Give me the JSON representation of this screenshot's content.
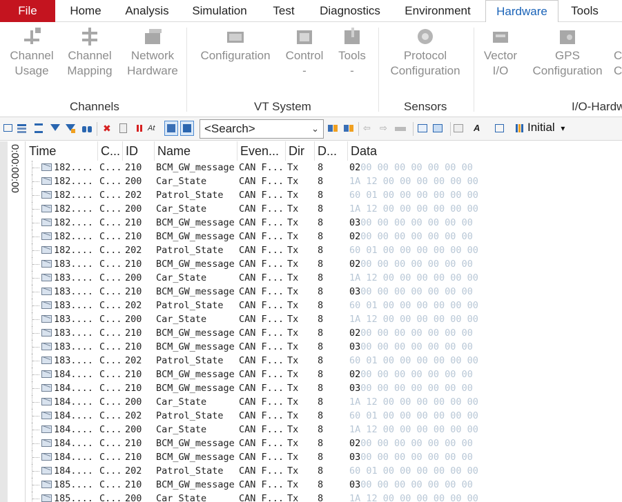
{
  "menu": {
    "tabs": [
      {
        "label": "File"
      },
      {
        "label": "Home"
      },
      {
        "label": "Analysis"
      },
      {
        "label": "Simulation"
      },
      {
        "label": "Test"
      },
      {
        "label": "Diagnostics"
      },
      {
        "label": "Environment"
      },
      {
        "label": "Hardware"
      },
      {
        "label": "Tools"
      }
    ],
    "active": "Hardware"
  },
  "ribbon": {
    "buttons": [
      {
        "line1": "Channel",
        "line2": "Usage"
      },
      {
        "line1": "Channel",
        "line2": "Mapping"
      },
      {
        "line1": "Network",
        "line2": "Hardware"
      },
      {
        "line1": "Configuration",
        "line2": ""
      },
      {
        "line1": "Control",
        "line2": "-"
      },
      {
        "line1": "Tools",
        "line2": "-"
      },
      {
        "line1": "Protocol",
        "line2": "Configuration"
      },
      {
        "line1": "Vector",
        "line2": "I/O"
      },
      {
        "line1": "GPS",
        "line2": "Configuration"
      },
      {
        "line1": "C",
        "line2": "C"
      }
    ],
    "groups": [
      "Channels",
      "VT System",
      "Sensors",
      "I/O-Hardw"
    ]
  },
  "toolbar": {
    "search_text": "<Search>",
    "search_dropdown": "⌄",
    "layout_label": "Initial",
    "layout_dropdown": "▾"
  },
  "side": {
    "time_label": "0:00:00:00"
  },
  "table": {
    "columns": [
      "Time",
      "C...",
      "ID",
      "Name",
      "Even...",
      "Dir",
      "D...",
      "Data"
    ],
    "rows": [
      {
        "time": "182....",
        "chn": "C...",
        "id": "210",
        "name": "BCM_GW_message",
        "event": "CAN F...",
        "dir": "Tx",
        "dlc": "8",
        "b0": "02",
        "rest": "00 00 00 00 00 00 00"
      },
      {
        "time": "182....",
        "chn": "C...",
        "id": "200",
        "name": "Car_State",
        "event": "CAN F...",
        "dir": "Tx",
        "dlc": "8",
        "b0": "",
        "rest": "1A 12 00 00 00 00 00 00"
      },
      {
        "time": "182....",
        "chn": "C...",
        "id": "202",
        "name": "Patrol_State",
        "event": "CAN F...",
        "dir": "Tx",
        "dlc": "8",
        "b0": "",
        "rest": "60 01 00 00 00 00 00 00"
      },
      {
        "time": "182....",
        "chn": "C...",
        "id": "200",
        "name": "Car_State",
        "event": "CAN F...",
        "dir": "Tx",
        "dlc": "8",
        "b0": "",
        "rest": "1A 12 00 00 00 00 00 00"
      },
      {
        "time": "182....",
        "chn": "C...",
        "id": "210",
        "name": "BCM_GW_message",
        "event": "CAN F...",
        "dir": "Tx",
        "dlc": "8",
        "b0": "03",
        "rest": "00 00 00 00 00 00 00"
      },
      {
        "time": "182....",
        "chn": "C...",
        "id": "210",
        "name": "BCM_GW_message",
        "event": "CAN F...",
        "dir": "Tx",
        "dlc": "8",
        "b0": "02",
        "rest": "00 00 00 00 00 00 00"
      },
      {
        "time": "182....",
        "chn": "C...",
        "id": "202",
        "name": "Patrol_State",
        "event": "CAN F...",
        "dir": "Tx",
        "dlc": "8",
        "b0": "",
        "rest": "60 01 00 00 00 00 00 00"
      },
      {
        "time": "183....",
        "chn": "C...",
        "id": "210",
        "name": "BCM_GW_message",
        "event": "CAN F...",
        "dir": "Tx",
        "dlc": "8",
        "b0": "02",
        "rest": "00 00 00 00 00 00 00"
      },
      {
        "time": "183....",
        "chn": "C...",
        "id": "200",
        "name": "Car_State",
        "event": "CAN F...",
        "dir": "Tx",
        "dlc": "8",
        "b0": "",
        "rest": "1A 12 00 00 00 00 00 00"
      },
      {
        "time": "183....",
        "chn": "C...",
        "id": "210",
        "name": "BCM_GW_message",
        "event": "CAN F...",
        "dir": "Tx",
        "dlc": "8",
        "b0": "03",
        "rest": "00 00 00 00 00 00 00"
      },
      {
        "time": "183....",
        "chn": "C...",
        "id": "202",
        "name": "Patrol_State",
        "event": "CAN F...",
        "dir": "Tx",
        "dlc": "8",
        "b0": "",
        "rest": "60 01 00 00 00 00 00 00"
      },
      {
        "time": "183....",
        "chn": "C...",
        "id": "200",
        "name": "Car_State",
        "event": "CAN F...",
        "dir": "Tx",
        "dlc": "8",
        "b0": "",
        "rest": "1A 12 00 00 00 00 00 00"
      },
      {
        "time": "183....",
        "chn": "C...",
        "id": "210",
        "name": "BCM_GW_message",
        "event": "CAN F...",
        "dir": "Tx",
        "dlc": "8",
        "b0": "02",
        "rest": "00 00 00 00 00 00 00"
      },
      {
        "time": "183....",
        "chn": "C...",
        "id": "210",
        "name": "BCM_GW_message",
        "event": "CAN F...",
        "dir": "Tx",
        "dlc": "8",
        "b0": "03",
        "rest": "00 00 00 00 00 00 00"
      },
      {
        "time": "183....",
        "chn": "C...",
        "id": "202",
        "name": "Patrol_State",
        "event": "CAN F...",
        "dir": "Tx",
        "dlc": "8",
        "b0": "",
        "rest": "60 01 00 00 00 00 00 00"
      },
      {
        "time": "184....",
        "chn": "C...",
        "id": "210",
        "name": "BCM_GW_message",
        "event": "CAN F...",
        "dir": "Tx",
        "dlc": "8",
        "b0": "02",
        "rest": "00 00 00 00 00 00 00"
      },
      {
        "time": "184....",
        "chn": "C...",
        "id": "210",
        "name": "BCM_GW_message",
        "event": "CAN F...",
        "dir": "Tx",
        "dlc": "8",
        "b0": "03",
        "rest": "00 00 00 00 00 00 00"
      },
      {
        "time": "184....",
        "chn": "C...",
        "id": "200",
        "name": "Car_State",
        "event": "CAN F...",
        "dir": "Tx",
        "dlc": "8",
        "b0": "",
        "rest": "1A 12 00 00 00 00 00 00"
      },
      {
        "time": "184....",
        "chn": "C...",
        "id": "202",
        "name": "Patrol_State",
        "event": "CAN F...",
        "dir": "Tx",
        "dlc": "8",
        "b0": "",
        "rest": "60 01 00 00 00 00 00 00"
      },
      {
        "time": "184....",
        "chn": "C...",
        "id": "200",
        "name": "Car_State",
        "event": "CAN F...",
        "dir": "Tx",
        "dlc": "8",
        "b0": "",
        "rest": "1A 12 00 00 00 00 00 00"
      },
      {
        "time": "184....",
        "chn": "C...",
        "id": "210",
        "name": "BCM_GW_message",
        "event": "CAN F...",
        "dir": "Tx",
        "dlc": "8",
        "b0": "02",
        "rest": "00 00 00 00 00 00 00"
      },
      {
        "time": "184....",
        "chn": "C...",
        "id": "210",
        "name": "BCM_GW_message",
        "event": "CAN F...",
        "dir": "Tx",
        "dlc": "8",
        "b0": "03",
        "rest": "00 00 00 00 00 00 00"
      },
      {
        "time": "184....",
        "chn": "C...",
        "id": "202",
        "name": "Patrol_State",
        "event": "CAN F...",
        "dir": "Tx",
        "dlc": "8",
        "b0": "",
        "rest": "60 01 00 00 00 00 00 00"
      },
      {
        "time": "185....",
        "chn": "C...",
        "id": "210",
        "name": "BCM_GW_message",
        "event": "CAN F...",
        "dir": "Tx",
        "dlc": "8",
        "b0": "03",
        "rest": "00 00 00 00 00 00 00"
      },
      {
        "time": "185....",
        "chn": "C...",
        "id": "200",
        "name": "Car_State",
        "event": "CAN F...",
        "dir": "Tx",
        "dlc": "8",
        "b0": "",
        "rest": "1A 12 00 00 00 00 00 00"
      }
    ]
  }
}
